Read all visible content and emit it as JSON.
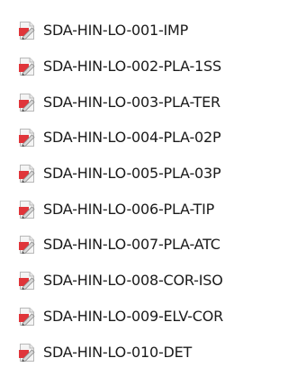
{
  "files": [
    {
      "name": "SDA-HIN-LO-001-IMP",
      "icon": "pdf-file-icon"
    },
    {
      "name": "SDA-HIN-LO-002-PLA-1SS",
      "icon": "pdf-file-icon"
    },
    {
      "name": "SDA-HIN-LO-003-PLA-TER",
      "icon": "pdf-file-icon"
    },
    {
      "name": "SDA-HIN-LO-004-PLA-02P",
      "icon": "pdf-file-icon"
    },
    {
      "name": "SDA-HIN-LO-005-PLA-03P",
      "icon": "pdf-file-icon"
    },
    {
      "name": "SDA-HIN-LO-006-PLA-TIP",
      "icon": "pdf-file-icon"
    },
    {
      "name": "SDA-HIN-LO-007-PLA-ATC",
      "icon": "pdf-file-icon"
    },
    {
      "name": "SDA-HIN-LO-008-COR-ISO",
      "icon": "pdf-file-icon"
    },
    {
      "name": "SDA-HIN-LO-009-ELV-COR",
      "icon": "pdf-file-icon"
    },
    {
      "name": "SDA-HIN-LO-010-DET",
      "icon": "pdf-file-icon"
    }
  ],
  "colors": {
    "icon_page": "#f4f4f4",
    "icon_border": "#b8b8b8",
    "icon_red": "#e0353a",
    "icon_pen": "#d9d9d9",
    "text": "#1a1a1a"
  }
}
